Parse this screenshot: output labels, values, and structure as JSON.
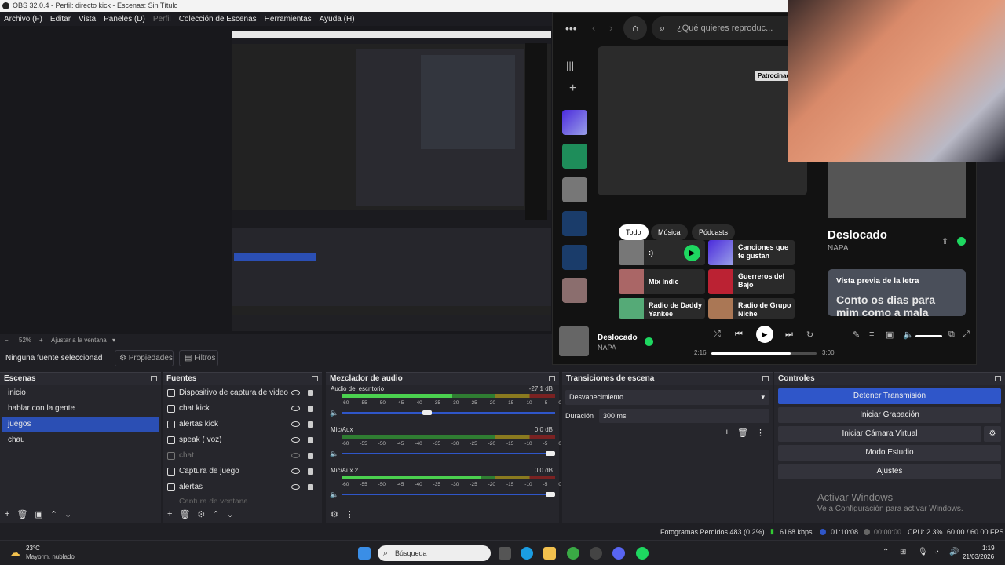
{
  "window": {
    "title": "OBS 32.0.4 - Perfil: directo kick - Escenas: Sin Título"
  },
  "menu": {
    "items": [
      "Archivo (F)",
      "Editar",
      "Vista",
      "Paneles (D)",
      "Perfil",
      "Colección de Escenas",
      "Herramientas",
      "Ayuda (H)"
    ]
  },
  "zoom": {
    "level": "52%",
    "fit_label": "Ajustar a la ventana"
  },
  "source_bar": {
    "status": "Ninguna fuente seleccionad",
    "properties": "Propiedades",
    "filters": "Filtros"
  },
  "scenes": {
    "title": "Escenas",
    "items": [
      "inicio",
      "hablar con la gente",
      "juegos",
      "chau"
    ],
    "selected": "juegos"
  },
  "sources": {
    "title": "Fuentes",
    "items": [
      "Dispositivo de captura de video",
      "chat kick",
      "alertas kick",
      "speak ( voz)",
      "chat",
      "Captura de juego",
      "alertas",
      "Captura de ventana"
    ]
  },
  "mixer": {
    "title": "Mezclador de audio",
    "channels": [
      {
        "name": "Audio del escritorio",
        "db": "-27.1 dB",
        "level": 0.52,
        "volume": 0.4
      },
      {
        "name": "Mic/Aux",
        "db": "0.0 dB",
        "level": 0.0,
        "volume": 1.0
      },
      {
        "name": "Mic/Aux 2",
        "db": "0.0 dB",
        "level": 0.65,
        "volume": 1.0
      }
    ],
    "scale": [
      "-60",
      "-55",
      "-50",
      "-45",
      "-40",
      "-35",
      "-30",
      "-25",
      "-20",
      "-15",
      "-10",
      "-5",
      "0"
    ]
  },
  "transitions": {
    "title": "Transiciones de escena",
    "type": "Desvanecimiento",
    "duration_label": "Duración",
    "duration_value": "300 ms"
  },
  "controls": {
    "title": "Controles",
    "buttons": [
      "Detener Transmisión",
      "Iniciar Grabación",
      "Iniciar Cámara Virtual",
      "Modo Estudio",
      "Ajustes"
    ]
  },
  "status": {
    "dropped": "Fotogramas Perdidos 483 (0.2%)",
    "bitrate": "6168 kbps",
    "stream_time": "01:10:08",
    "rec_time": "00:00:00",
    "cpu": "CPU: 2.3%",
    "fps": "60.00 / 60.00 FPS"
  },
  "activate": {
    "title": "Activar Windows",
    "subtitle": "Ve a Configuración para activar Windows."
  },
  "spotify": {
    "search_placeholder": "¿Qué quieres reproduc...",
    "sponsored": "Patrocinado",
    "chips": [
      "Todo",
      "Música",
      "Pódcasts"
    ],
    "cards": [
      {
        "title": ":)"
      },
      {
        "title": "Canciones que te gustan"
      },
      {
        "title": "Mix Indie"
      },
      {
        "title": "Guerreros del Bajo"
      },
      {
        "title": "Radio de Daddy Yankee"
      },
      {
        "title": "Radio de Grupo Niche"
      }
    ],
    "now_playing": {
      "title": "Deslocado",
      "artist": "NAPA",
      "elapsed": "2:16",
      "duration": "3:00",
      "progress": 0.755
    },
    "side": {
      "title": "Deslocado",
      "artist": "NAPA",
      "lyrics_header": "Vista previa de la letra",
      "lyrics": "Conto os dias para mim como a mala"
    }
  },
  "taskbar": {
    "weather_temp": "23°C",
    "weather_desc": "Mayorm. nublado",
    "search": "Búsqueda",
    "time": "1:19",
    "date": "21/03/2026"
  },
  "colors": {
    "accent": "#2f56c9",
    "spotify_green": "#1ed760"
  }
}
